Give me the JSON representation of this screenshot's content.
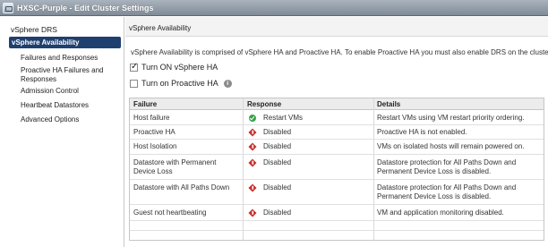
{
  "window": {
    "title": "HXSC-Purple - Edit Cluster Settings"
  },
  "sidebar": {
    "items": [
      {
        "label": "vSphere DRS"
      },
      {
        "label": "vSphere Availability"
      },
      {
        "label": "Failures and Responses"
      },
      {
        "label": "Proactive HA Failures and Responses"
      },
      {
        "label": "Admission Control"
      },
      {
        "label": "Heartbeat Datastores"
      },
      {
        "label": "Advanced Options"
      }
    ]
  },
  "main": {
    "section_title": "vSphere Availability",
    "description": "vSphere Availability is comprised of vSphere HA and Proactive HA. To enable Proactive HA you must also enable DRS on the cluster.",
    "turn_on_ha": {
      "label": "Turn ON vSphere HA",
      "checked": true
    },
    "turn_on_proactive": {
      "label": "Turn on Proactive HA",
      "checked": false
    }
  },
  "table": {
    "headers": [
      "Failure",
      "Response",
      "Details"
    ],
    "rows": [
      {
        "failure": "Host failure",
        "response": "Restart VMs",
        "status": "ok",
        "details": "Restart VMs using VM restart priority ordering."
      },
      {
        "failure": "Proactive HA",
        "response": "Disabled",
        "status": "disabled",
        "details": "Proactive HA is not enabled."
      },
      {
        "failure": "Host Isolation",
        "response": "Disabled",
        "status": "disabled",
        "details": "VMs on isolated hosts will remain powered on."
      },
      {
        "failure": "Datastore with Permanent Device Loss",
        "response": "Disabled",
        "status": "disabled",
        "details": "Datastore protection for All Paths Down and Permanent Device Loss is disabled."
      },
      {
        "failure": "Datastore with All Paths Down",
        "response": "Disabled",
        "status": "disabled",
        "details": "Datastore protection for All Paths Down and Permanent Device Loss is disabled."
      },
      {
        "failure": "Guest not heartbeating",
        "response": "Disabled",
        "status": "disabled",
        "details": "VM and application monitoring disabled."
      }
    ]
  },
  "colors": {
    "nav_active_bg": "#1f3f6e",
    "ok": "#36a34a",
    "error": "#c9302c"
  }
}
